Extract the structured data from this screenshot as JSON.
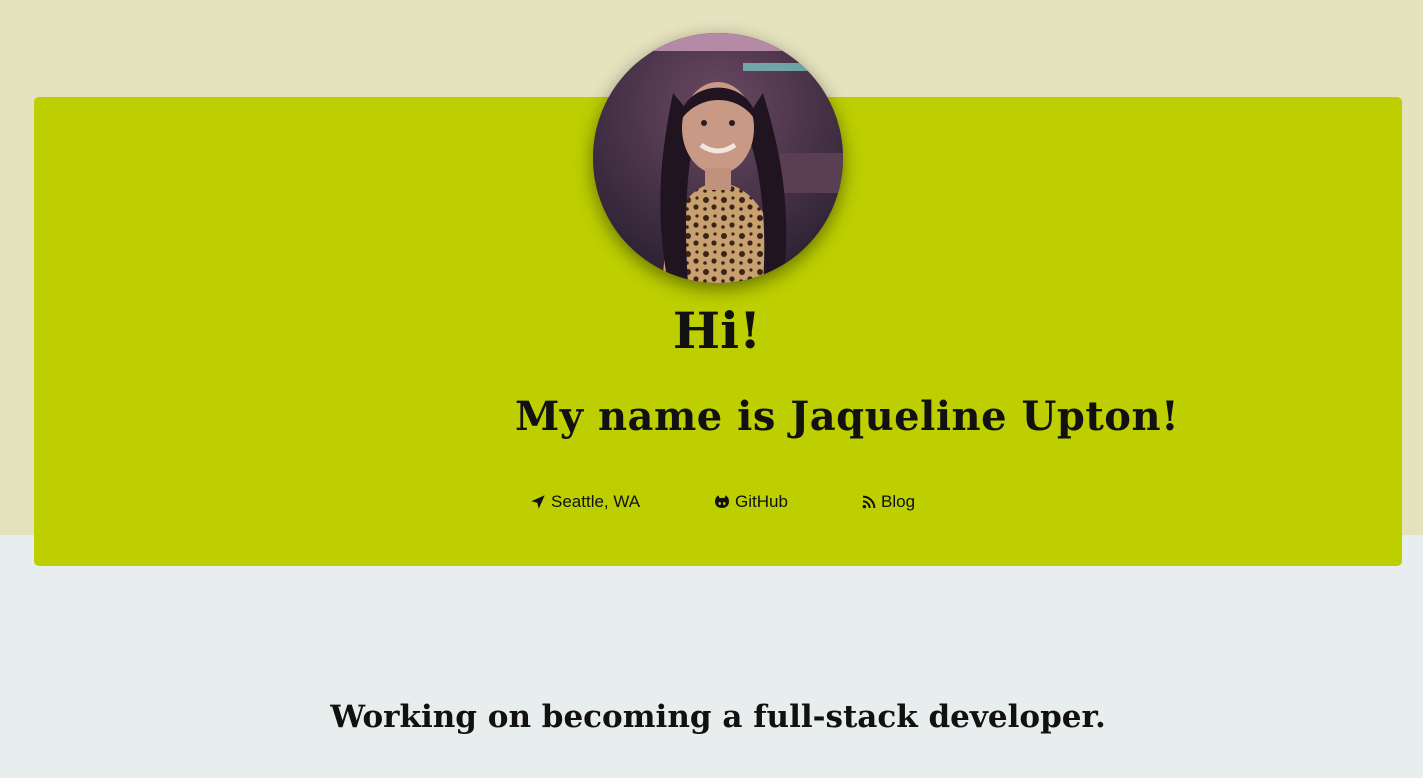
{
  "hero": {
    "avatar_alt": "Profile photo",
    "greeting": "Hi!",
    "name_line": "My name is Jaqueline Upton!",
    "links": [
      {
        "label": "Seattle, WA",
        "icon": "location-arrow-icon"
      },
      {
        "label": "GitHub",
        "icon": "github-icon"
      },
      {
        "label": "Blog",
        "icon": "rss-icon"
      }
    ]
  },
  "about": {
    "tagline": "Working on becoming a full-stack developer."
  },
  "colors": {
    "top_band": "#e5e2be",
    "card": "#bdcf00",
    "page_bottom": "#e8eeed",
    "text": "#111111"
  }
}
